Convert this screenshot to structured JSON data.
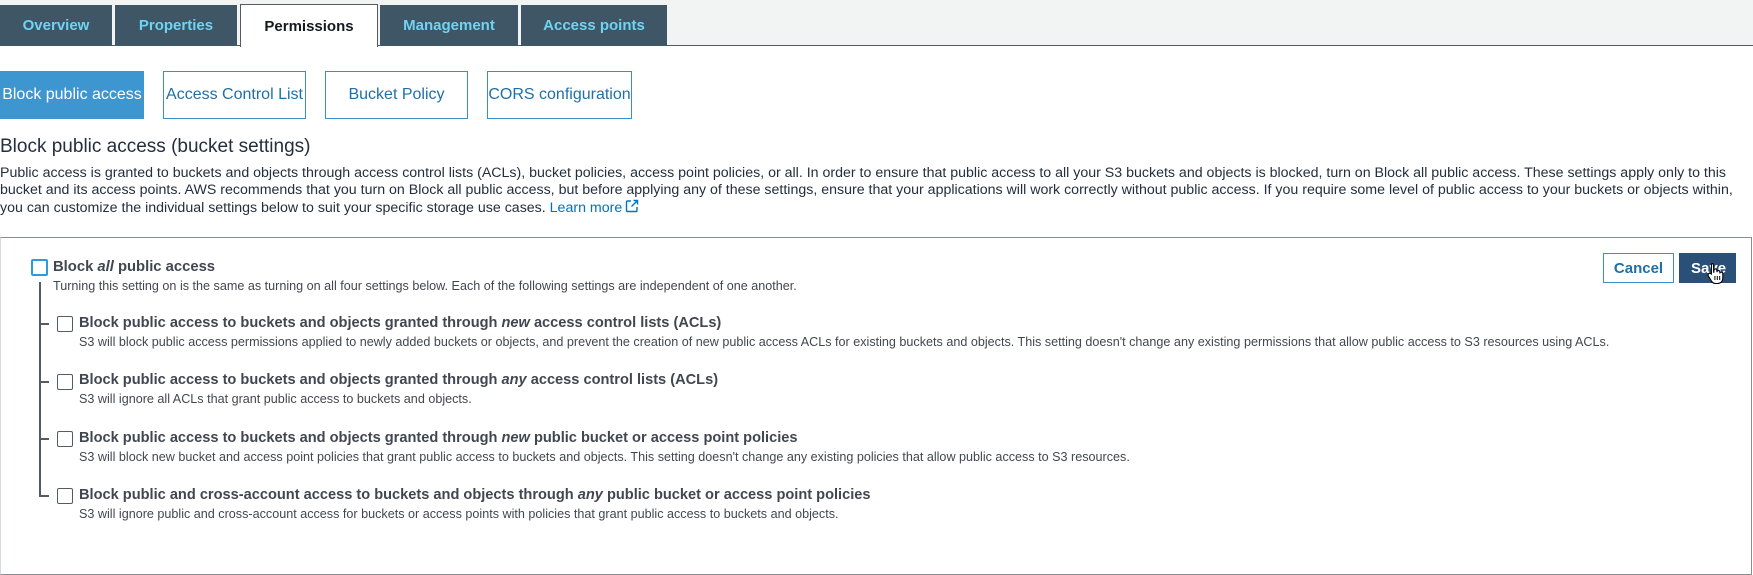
{
  "tabs": [
    {
      "label": "Overview",
      "active": false
    },
    {
      "label": "Properties",
      "active": false
    },
    {
      "label": "Permissions",
      "active": true
    },
    {
      "label": "Management",
      "active": false
    },
    {
      "label": "Access points",
      "active": false
    }
  ],
  "subtabs": [
    {
      "label": "Block public access",
      "active": true
    },
    {
      "label": "Access Control List",
      "active": false
    },
    {
      "label": "Bucket Policy",
      "active": false
    },
    {
      "label": "CORS configuration",
      "active": false
    }
  ],
  "section": {
    "title": "Block public access (bucket settings)",
    "intro": "Public access is granted to buckets and objects through access control lists (ACLs), bucket policies, access point policies, or all. In order to ensure that public access to all your S3 buckets and objects is blocked, turn on Block all public access. These settings apply only to this bucket and its access points. AWS recommends that you turn on Block all public access, but before applying any of these settings, ensure that your applications will work correctly without public access. If you require some level of public access to your buckets or objects within, you can customize the individual settings below to suit your specific storage use cases.",
    "learn_more": "Learn more"
  },
  "block_all": {
    "title_pre": "Block ",
    "title_em": "all",
    "title_post": " public access",
    "description": "Turning this setting on is the same as turning on all four settings below. Each of the following settings are independent of one another.",
    "checked": false
  },
  "options": [
    {
      "title_pre": "Block public access to buckets and objects granted through ",
      "title_em": "new",
      "title_post": " access control lists (ACLs)",
      "description": "S3 will block public access permissions applied to newly added buckets or objects, and prevent the creation of new public access ACLs for existing buckets and objects. This setting doesn't change any existing permissions that allow public access to S3 resources using ACLs.",
      "checked": false
    },
    {
      "title_pre": "Block public access to buckets and objects granted through ",
      "title_em": "any",
      "title_post": " access control lists (ACLs)",
      "description": "S3 will ignore all ACLs that grant public access to buckets and objects.",
      "checked": false
    },
    {
      "title_pre": "Block public access to buckets and objects granted through ",
      "title_em": "new",
      "title_post": " public bucket or access point policies",
      "description": "S3 will block new bucket and access point policies that grant public access to buckets and objects. This setting doesn't change any existing policies that allow public access to S3 resources.",
      "checked": false
    },
    {
      "title_pre": "Block public and cross-account access to buckets and objects through ",
      "title_em": "any",
      "title_post": " public bucket or access point policies",
      "description": "S3 will ignore public and cross-account access for buckets or access points with policies that grant public access to buckets and objects.",
      "checked": false
    }
  ],
  "buttons": {
    "cancel": "Cancel",
    "save": "Save"
  },
  "icons": {
    "external_link": "external-link-icon",
    "cursor": "hand-pointer-icon"
  },
  "colors": {
    "tab_bg": "#3e5665",
    "tab_text": "#6fd3f3",
    "subtab_active": "#3d96d0",
    "link": "#0073bb",
    "save_button": "#2b5078",
    "checkbox_focus": "#2f9ad8"
  }
}
